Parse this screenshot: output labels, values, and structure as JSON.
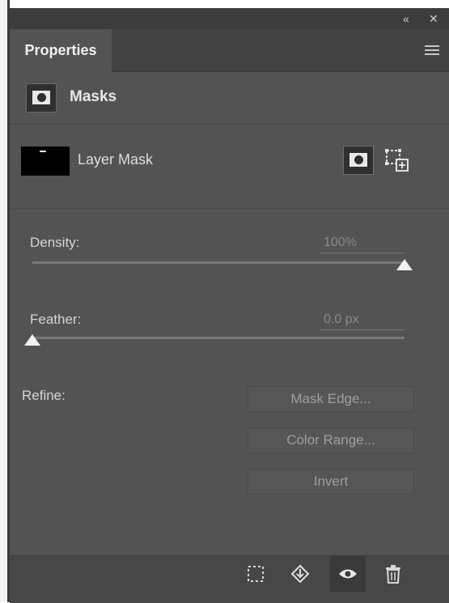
{
  "titlebar": {
    "collapse_glyph": "«",
    "close_glyph": "✕"
  },
  "tabs": [
    {
      "label": "Properties"
    }
  ],
  "masks_header": {
    "label": "Masks"
  },
  "layer_mask": {
    "label": "Layer Mask"
  },
  "density": {
    "label": "Density:",
    "value": "100%",
    "slider_percent": 100
  },
  "feather": {
    "label": "Feather:",
    "value": "0.0 px",
    "slider_percent": 0
  },
  "refine": {
    "label": "Refine:",
    "buttons": [
      {
        "label": "Mask Edge..."
      },
      {
        "label": "Color Range..."
      },
      {
        "label": "Invert"
      }
    ]
  },
  "footer_icons": [
    "load-selection-icon",
    "apply-mask-icon",
    "eye-icon",
    "trash-icon"
  ],
  "colors": {
    "panel_bg": "#535353",
    "header_bg": "#424242",
    "footer_bg": "#474747"
  }
}
